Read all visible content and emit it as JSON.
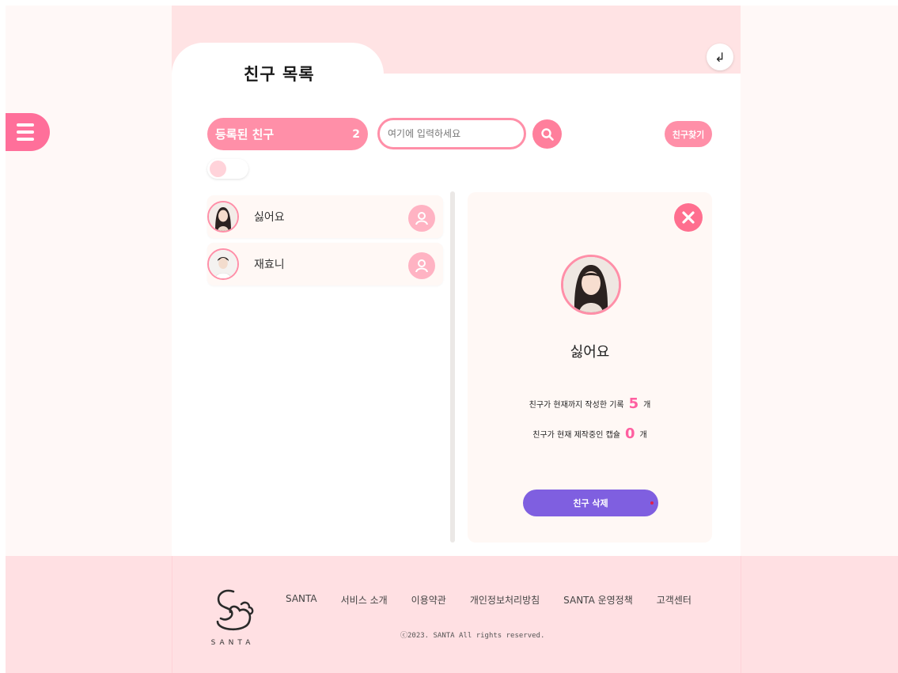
{
  "page": {
    "title": "친구 목록"
  },
  "header": {
    "back_icon": "back-arrow-icon",
    "back_glyph": "↲"
  },
  "menu": {
    "icon": "hamburger-menu-icon"
  },
  "toolbar": {
    "registered_label": "등록된 친구",
    "registered_count": "2",
    "search_placeholder": "여기에 입력하세요",
    "find_friend_label": "친구찾기"
  },
  "friends": [
    {
      "name": "싫어요",
      "action_icon": "user-profile-icon"
    },
    {
      "name": "재효니",
      "action_icon": "user-profile-icon"
    }
  ],
  "detail": {
    "name": "싫어요",
    "records_prefix": "친구가 현재까지 작성한 기록",
    "records_count": "5",
    "records_unit": "개",
    "capsules_prefix": "친구가 현재 제작중인 캡슐",
    "capsules_count": "0",
    "capsules_unit": "개",
    "delete_label": "친구 삭제"
  },
  "footer": {
    "logo_text": "SANTA",
    "links": [
      "SANTA",
      "서비스 소개",
      "이용약관",
      "개인정보처리방침",
      "SANTA 운영정책",
      "고객센터"
    ],
    "copyright": "ⓒ2023. SANTA All rights reserved."
  },
  "colors": {
    "accent_pink": "#ff8fa8",
    "button_purple": "#7f5fe0",
    "count_pink": "#ff5fa0"
  }
}
